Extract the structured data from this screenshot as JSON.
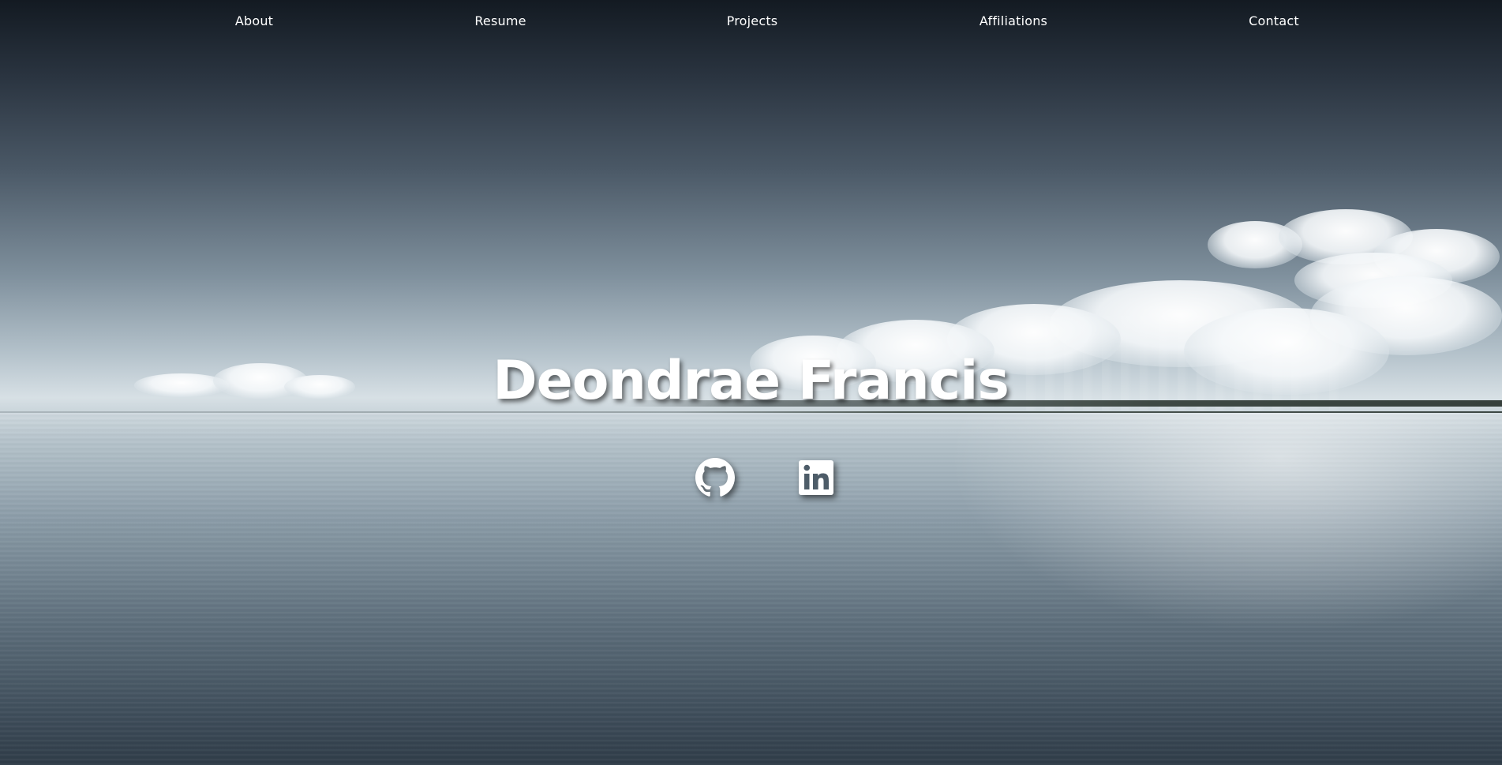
{
  "nav": {
    "links": [
      {
        "label": "About"
      },
      {
        "label": "Resume"
      },
      {
        "label": "Projects"
      },
      {
        "label": "Affiliations"
      },
      {
        "label": "Contact"
      }
    ]
  },
  "hero": {
    "name": "Deondrae Francis"
  },
  "social": [
    {
      "icon": "github-icon"
    },
    {
      "icon": "linkedin-icon"
    }
  ],
  "colors": {
    "text": "#ffffff",
    "sky_top": "#131a22",
    "horizon": "#d7e0e5",
    "water_bottom": "#2b3844"
  }
}
